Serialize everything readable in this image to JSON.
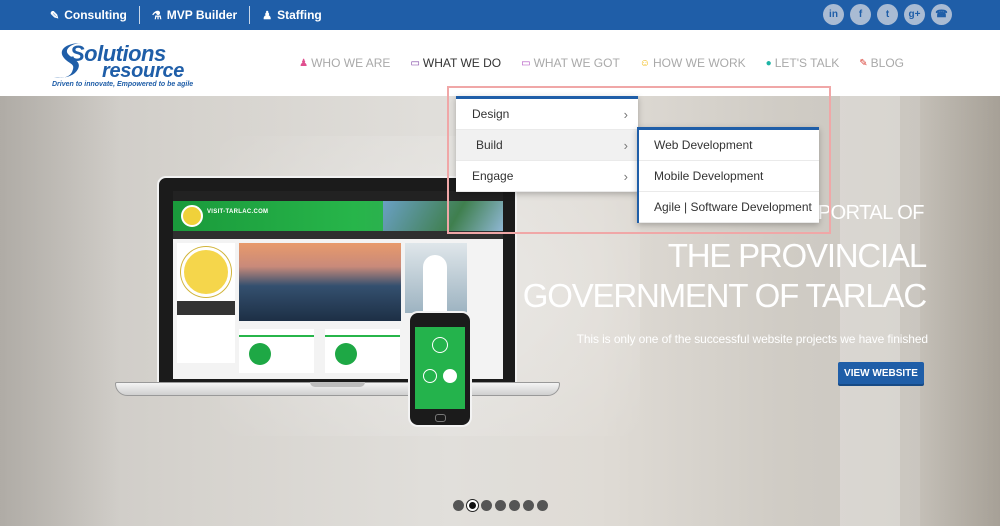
{
  "topbar": {
    "links": [
      {
        "icon": "edit-icon",
        "label": "Consulting"
      },
      {
        "icon": "flask-icon",
        "label": "MVP Builder"
      },
      {
        "icon": "users-icon",
        "label": "Staffing"
      }
    ],
    "social": [
      {
        "icon": "linkedin-icon",
        "glyph": "in"
      },
      {
        "icon": "facebook-icon",
        "glyph": "f"
      },
      {
        "icon": "twitter-icon",
        "glyph": "t"
      },
      {
        "icon": "googleplus-icon",
        "glyph": "g+"
      },
      {
        "icon": "phone-icon",
        "glyph": "☎"
      }
    ]
  },
  "logo": {
    "line1": "Solutions",
    "line2": "resource",
    "tagline": "Driven to innovate, Empowered to be agile"
  },
  "nav": {
    "items": [
      {
        "label": "WHO WE ARE",
        "icon": "person-icon",
        "color": "#e0508f",
        "glyph": "♟"
      },
      {
        "label": "WHAT WE DO",
        "icon": "monitor-icon",
        "color": "#7b3fa0",
        "glyph": "▭"
      },
      {
        "label": "WHAT WE GOT",
        "icon": "screen-icon",
        "color": "#b04fc0",
        "glyph": "▭"
      },
      {
        "label": "HOW WE WORK",
        "icon": "smile-icon",
        "color": "#f0b400",
        "glyph": "☺"
      },
      {
        "label": "LET'S TALK",
        "icon": "chat-icon",
        "color": "#1db4a5",
        "glyph": "●"
      },
      {
        "label": "BLOG",
        "icon": "pencil-icon",
        "color": "#d9443a",
        "glyph": "✎"
      }
    ],
    "active_index": 1
  },
  "dropdown": {
    "items": [
      {
        "label": "Design"
      },
      {
        "label": "Build"
      },
      {
        "label": "Engage"
      }
    ],
    "chevron": "›"
  },
  "submenu": {
    "items": [
      {
        "label": "Web Development"
      },
      {
        "label": "Mobile Development"
      },
      {
        "label": "Agile | Software Development"
      }
    ]
  },
  "hero": {
    "line1": "THE OFFICIAL PORTAL OF",
    "line2": "THE PROVINCIAL",
    "line3": "GOVERNMENT OF TARLAC",
    "subtitle": "This is only one of the successful website projects we have finished",
    "button": "VIEW WEBSITE",
    "slides_total": 7,
    "active_slide": 2
  },
  "mockup": {
    "site_name": "VISIT-TARLAC.COM"
  },
  "colors": {
    "brand": "#1f5ea8",
    "highlight": "#f0a7a7"
  }
}
